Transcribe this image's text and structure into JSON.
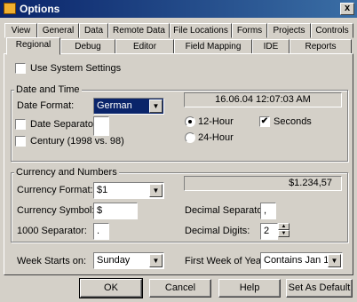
{
  "window": {
    "title": "Options",
    "close_glyph": "x"
  },
  "tabs_row1": [
    "View",
    "General",
    "Data",
    "Remote Data",
    "File Locations",
    "Forms",
    "Projects",
    "Controls"
  ],
  "tabs_row2": [
    "Regional",
    "Debug",
    "Editor",
    "Field Mapping",
    "IDE",
    "Reports"
  ],
  "use_system_settings": {
    "label": "Use System Settings",
    "checked": false
  },
  "date_time": {
    "group_label": "Date and Time",
    "date_format_label": "Date Format:",
    "date_format_value": "German",
    "preview": "16.06.04 12:07:03 AM",
    "date_separator_label": "Date Separator:",
    "date_separator_value": "",
    "century_label": "Century (1998 vs. 98)",
    "hour12_label": "12-Hour",
    "hour24_label": "24-Hour",
    "seconds_label": "Seconds",
    "check_glyph": "✔"
  },
  "currency_numbers": {
    "group_label": "Currency and Numbers",
    "currency_format_label": "Currency Format:",
    "currency_format_value": "$1",
    "preview": "$1.234,57",
    "currency_symbol_label": "Currency Symbol:",
    "currency_symbol_value": "$",
    "decimal_separator_label": "Decimal Separator:",
    "decimal_separator_value": ",",
    "thousand_separator_label": "1000 Separator:",
    "thousand_separator_value": ".",
    "decimal_digits_label": "Decimal Digits:",
    "decimal_digits_value": "2"
  },
  "week": {
    "week_starts_label": "Week Starts on:",
    "week_starts_value": "Sunday",
    "first_week_label": "First Week of Year:",
    "first_week_value": "Contains Jan 1"
  },
  "buttons": {
    "ok": "OK",
    "cancel": "Cancel",
    "help": "Help",
    "set_default": "Set As Default"
  },
  "glyphs": {
    "dropdown": "▼",
    "spin_up": "▲",
    "spin_down": "▼"
  }
}
